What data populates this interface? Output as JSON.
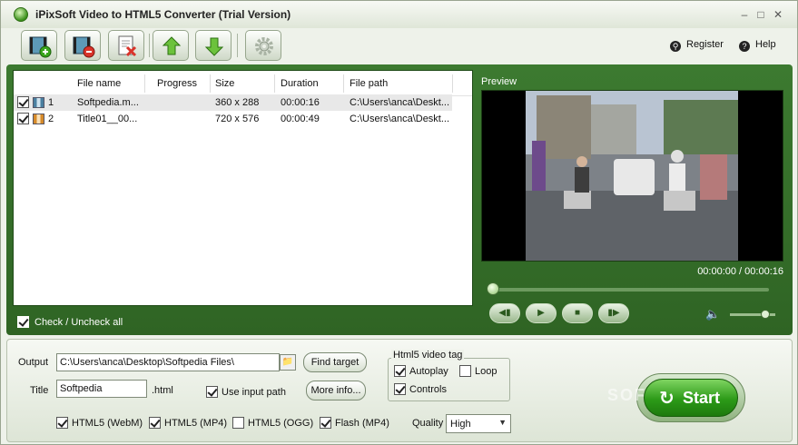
{
  "window": {
    "title": "iPixSoft Video to HTML5 Converter (Trial Version)"
  },
  "toolbar": {
    "buttons": [
      {
        "name": "add-video",
        "icon": "film-add-icon"
      },
      {
        "name": "remove-video",
        "icon": "film-remove-icon"
      },
      {
        "name": "clear-list",
        "icon": "document-delete-icon"
      },
      {
        "name": "move-up",
        "icon": "arrow-up-icon"
      },
      {
        "name": "move-down",
        "icon": "arrow-down-icon"
      },
      {
        "name": "settings",
        "icon": "gear-icon"
      }
    ],
    "register_label": "Register",
    "help_label": "Help"
  },
  "file_list": {
    "columns": [
      "File name",
      "Progress",
      "Size",
      "Duration",
      "File path"
    ],
    "rows": [
      {
        "index": "1",
        "checked": true,
        "file_name": "Softpedia.m...",
        "progress": "",
        "size": "360 x 288",
        "duration": "00:00:16",
        "file_path": "C:\\Users\\anca\\Deskt..."
      },
      {
        "index": "2",
        "checked": true,
        "file_name": "Title01__00...",
        "progress": "",
        "size": "720 x 576",
        "duration": "00:00:49",
        "file_path": "C:\\Users\\anca\\Deskt..."
      }
    ],
    "check_all_label": "Check / Uncheck all"
  },
  "preview": {
    "label": "Preview",
    "time": "00:00:00 / 00:00:16",
    "seek_fraction": 0.02,
    "volume_fraction": 0.9
  },
  "output": {
    "output_label": "Output",
    "output_path": "C:\\Users\\anca\\Desktop\\Softpedia Files\\",
    "find_target_label": "Find target",
    "title_label": "Title",
    "title_value": "Softpedia",
    "ext_label": ".html",
    "use_input_path_label": "Use input path",
    "more_info_label": "More info...",
    "html5_tag_title": "Html5 video tag",
    "autoplay_label": "Autoplay",
    "loop_label": "Loop",
    "controls_label": "Controls",
    "formats": [
      {
        "label": "HTML5 (WebM)",
        "checked": true
      },
      {
        "label": "HTML5 (MP4)",
        "checked": true
      },
      {
        "label": "HTML5 (OGG)",
        "checked": false
      },
      {
        "label": "Flash (MP4)",
        "checked": true
      }
    ],
    "quality_label": "Quality",
    "quality_value": "High",
    "start_label": "Start",
    "watermark": "SOFTPEDIA"
  }
}
